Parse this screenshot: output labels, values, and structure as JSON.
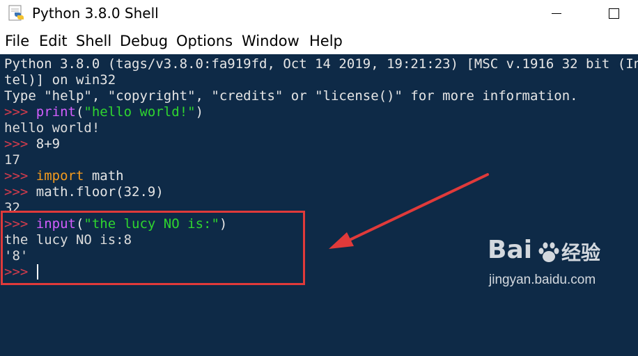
{
  "window": {
    "title": "Python 3.8.0 Shell",
    "icon": "python-idle-icon",
    "controls": {
      "minimize_icon": "minimize-icon",
      "maximize_icon": "maximize-icon"
    }
  },
  "menu": {
    "items": [
      "File",
      "Edit",
      "Shell",
      "Debug",
      "Options",
      "Window",
      "Help"
    ]
  },
  "shell": {
    "banner_line1": "Python 3.8.0 (tags/v3.8.0:fa919fd, Oct 14 2019, 19:21:23) [MSC v.1916 32 bit (In",
    "banner_line2": "tel)] on win32",
    "banner_line3": "Type \"help\", \"copyright\", \"credits\" or \"license()\" for more information.",
    "prompt": ">>> ",
    "cmd1": {
      "func": "print",
      "open": "(",
      "str": "\"hello world!\"",
      "close": ")"
    },
    "out1": "hello world!",
    "cmd2": "8+9",
    "out2": "17",
    "cmd3": {
      "kw": "import",
      "rest": " math"
    },
    "cmd4": "math.floor(32.9)",
    "out4": "32",
    "cmd5": {
      "func": "input",
      "open": "(",
      "str": "\"the lucy NO is:\"",
      "close": ")"
    },
    "out5": "the lucy NO is:8",
    "out6": "'8'"
  },
  "watermark": {
    "logo_left": "Bai",
    "logo_right": "经验",
    "url": "jingyan.baidu.com"
  },
  "colors": {
    "shell_bg": "#0e2a47",
    "prompt": "#d43c4c",
    "builtin": "#d45eff",
    "keyword": "#f59b1d",
    "string": "#2fd52f",
    "annotation": "#e03a3a"
  }
}
